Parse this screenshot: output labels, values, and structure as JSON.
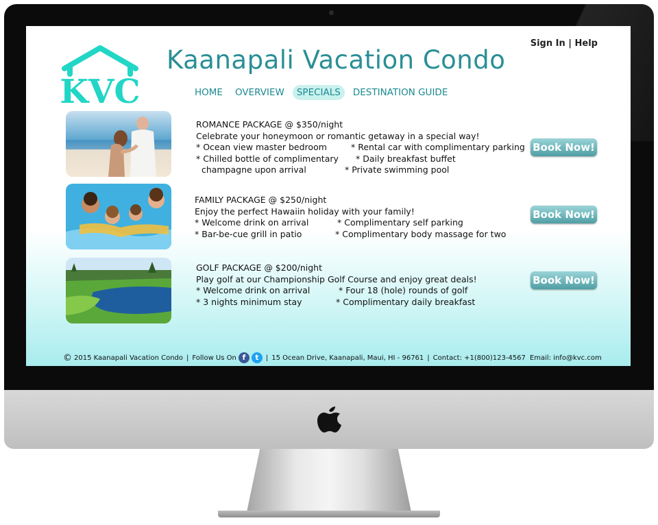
{
  "header": {
    "sign_in": "Sign In",
    "divider": "|",
    "help": "Help",
    "title": "Kaanapali Vacation Condo",
    "logo_text": "KVC"
  },
  "nav": [
    {
      "label": "HOME"
    },
    {
      "label": "OVERVIEW"
    },
    {
      "label": "SPECIALS"
    },
    {
      "label": "DESTINATION GUIDE"
    }
  ],
  "packages": [
    {
      "title": "ROMANCE PACKAGE @ $350/night",
      "desc": "Celebrate your honeymoon or romantic getaway in a special way!",
      "col1": [
        "* Ocean view master bedroom",
        "* Chilled bottle of complimentary",
        "  champagne upon arrival"
      ],
      "col2": [
        "* Rental car with complimentary parking",
        "* Daily breakfast buffet",
        "* Private swimming pool"
      ],
      "button": "Book Now!",
      "image": "couple-on-beach"
    },
    {
      "title": "FAMILY PACKAGE @ $250/night",
      "desc": "Enjoy the perfect Hawaiin holiday with your family!",
      "col1": [
        "* Welcome drink on arrival",
        "* Bar-be-cue grill in patio"
      ],
      "col2": [
        "* Complimentary self parking",
        "* Complimentary body massage for two"
      ],
      "button": "Book Now!",
      "image": "family-in-pool"
    },
    {
      "title": "GOLF PACKAGE @ $200/night",
      "desc": "Play golf at our Championship Golf Course and enjoy great deals!",
      "col1": [
        "* Welcome drink on arrival",
        "* 3 nights minimum stay"
      ],
      "col2": [
        "* Four 18 (hole) rounds of golf",
        "* Complimentary daily breakfast"
      ],
      "button": "Book Now!",
      "image": "golf-course"
    }
  ],
  "footer": {
    "copyright_symbol": "©",
    "copyright": "2015 Kaanapali Vacation Condo",
    "follow": "Follow Us On",
    "address": "15 Ocean Drive, Kaanapali, Maui, HI - 96761",
    "contact": "Contact: +1(800)123-4567",
    "email": "Email: info@kvc.com",
    "facebook_glyph": "f",
    "twitter_glyph": "t"
  },
  "colors": {
    "brand_teal": "#2a8f95",
    "logo_aqua": "#22d6c6",
    "button_top": "#9ad4d8",
    "button_bottom": "#4f9ea4"
  }
}
